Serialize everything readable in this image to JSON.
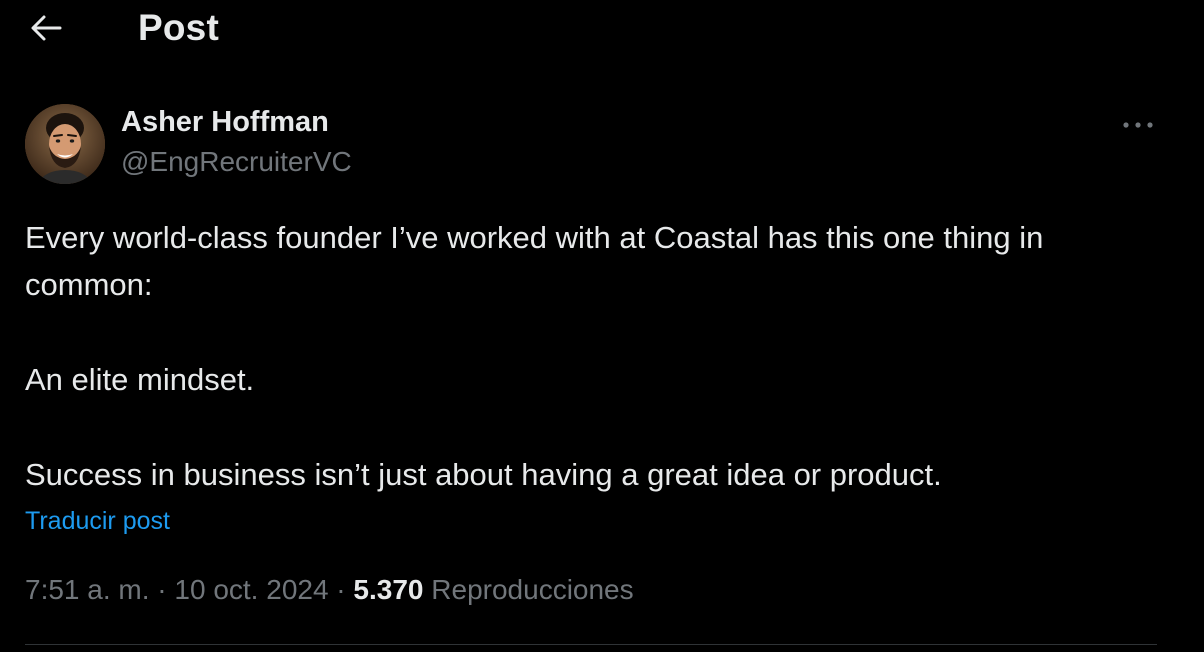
{
  "header": {
    "title": "Post",
    "back_icon": "arrow-left-icon"
  },
  "author": {
    "name": "Asher Hoffman",
    "handle": "@EngRecruiterVC",
    "avatar_icon": "avatar"
  },
  "post": {
    "paragraphs": [
      "Every world-class founder I’ve worked with at Coastal has this one thing in common:",
      "An elite mindset.",
      "Success in business isn’t just about having a great idea or product."
    ],
    "translate_label": "Traducir post"
  },
  "meta": {
    "time": "7:51 a. m.",
    "separator": " · ",
    "date": "10 oct. 2024",
    "views_count": "5.370",
    "views_label": "Reproducciones"
  },
  "colors": {
    "background": "#000000",
    "text_primary": "#e7e9ea",
    "text_secondary": "#71767b",
    "link": "#1d9bf0",
    "divider": "#2f3336"
  },
  "icons": {
    "back": "arrow-left-icon",
    "more": "more-horizontal-icon"
  }
}
